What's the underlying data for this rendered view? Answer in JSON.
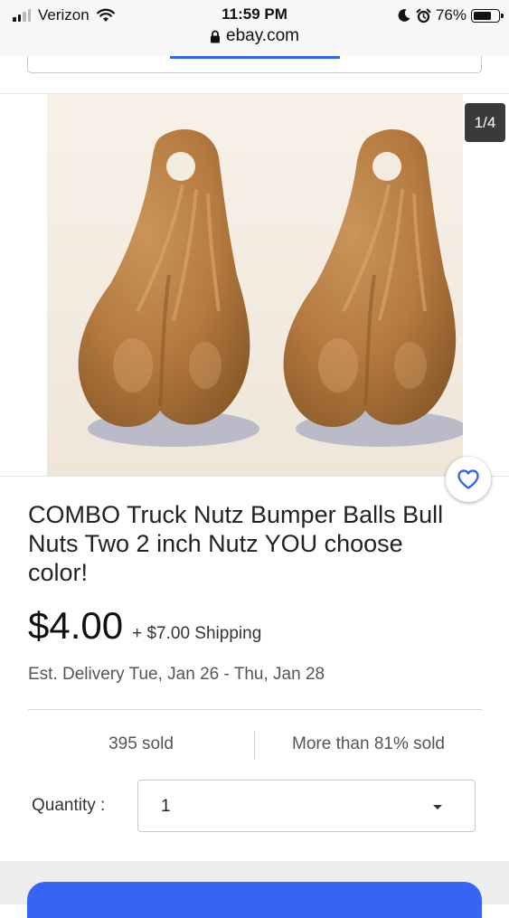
{
  "status_bar": {
    "carrier": "Verizon",
    "time": "11:59 PM",
    "battery_percent": "76%",
    "battery_level": 0.76,
    "url": "ebay.com",
    "icons": [
      "signal-icon",
      "wifi-icon",
      "moon-icon",
      "alarm-icon",
      "battery-icon",
      "lock-icon"
    ]
  },
  "gallery": {
    "counter": "1/4"
  },
  "product": {
    "title": "COMBO Truck Nutz Bumper Balls Bull Nuts Two 2 inch Nutz YOU choose color!",
    "price": "$4.00",
    "shipping": "+ $7.00 Shipping",
    "delivery": "Est. Delivery Tue, Jan 26 - Thu, Jan 28",
    "sold_count": "395 sold",
    "sold_percent": "More than 81% sold"
  },
  "quantity": {
    "label": "Quantity :",
    "value": "1"
  },
  "colors": {
    "accent": "#3665f3",
    "watch_heart": "#3665f3",
    "counter_bg": "#3a3a3a"
  }
}
